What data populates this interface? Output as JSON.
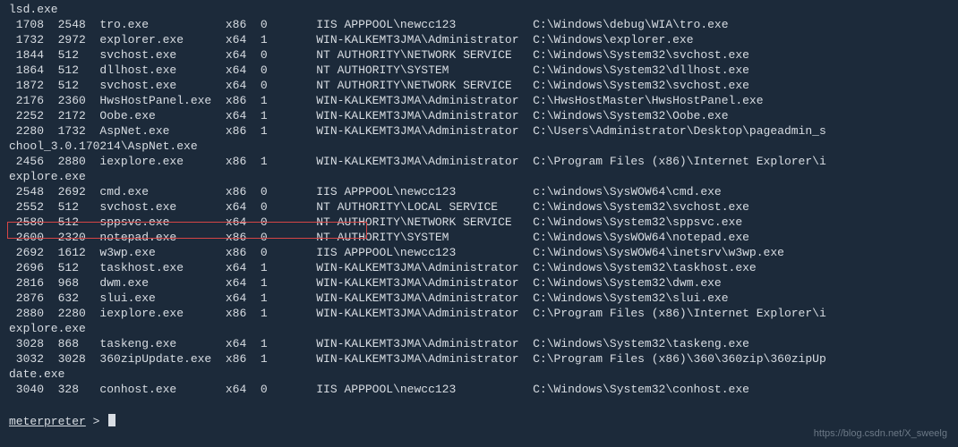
{
  "prompt": "meterpreter",
  "watermark": "https://blog.csdn.net/X_sweelg",
  "highlight_pid": 2600,
  "col_widths": {
    "pid": 6,
    "ppid": 6,
    "name": 18,
    "arch": 5,
    "sess": 4,
    "spacer": 4,
    "user": 30,
    "path_pad": 1
  },
  "wrap_lines": {
    "0": "lsd.exe",
    "9": "chool_3.0.170214\\AspNet.exe",
    "11": "explore.exe",
    "21": "explore.exe",
    "24": "date.exe"
  },
  "processes": [
    {
      "pid": 1708,
      "ppid": 2548,
      "name": "tro.exe",
      "arch": "x86",
      "sess": 0,
      "user": "IIS APPPOOL\\newcc123",
      "path": "C:\\Windows\\debug\\WIA\\tro.exe"
    },
    {
      "pid": 1732,
      "ppid": 2972,
      "name": "explorer.exe",
      "arch": "x64",
      "sess": 1,
      "user": "WIN-KALKEMT3JMA\\Administrator",
      "path": "C:\\Windows\\explorer.exe"
    },
    {
      "pid": 1844,
      "ppid": 512,
      "name": "svchost.exe",
      "arch": "x64",
      "sess": 0,
      "user": "NT AUTHORITY\\NETWORK SERVICE",
      "path": "C:\\Windows\\System32\\svchost.exe"
    },
    {
      "pid": 1864,
      "ppid": 512,
      "name": "dllhost.exe",
      "arch": "x64",
      "sess": 0,
      "user": "NT AUTHORITY\\SYSTEM",
      "path": "C:\\Windows\\System32\\dllhost.exe"
    },
    {
      "pid": 1872,
      "ppid": 512,
      "name": "svchost.exe",
      "arch": "x64",
      "sess": 0,
      "user": "NT AUTHORITY\\NETWORK SERVICE",
      "path": "C:\\Windows\\System32\\svchost.exe"
    },
    {
      "pid": 2176,
      "ppid": 2360,
      "name": "HwsHostPanel.exe",
      "arch": "x86",
      "sess": 1,
      "user": "WIN-KALKEMT3JMA\\Administrator",
      "path": "C:\\HwsHostMaster\\HwsHostPanel.exe"
    },
    {
      "pid": 2252,
      "ppid": 2172,
      "name": "Oobe.exe",
      "arch": "x64",
      "sess": 1,
      "user": "WIN-KALKEMT3JMA\\Administrator",
      "path": "C:\\Windows\\System32\\Oobe.exe"
    },
    {
      "pid": 2280,
      "ppid": 1732,
      "name": "AspNet.exe",
      "arch": "x86",
      "sess": 1,
      "user": "WIN-KALKEMT3JMA\\Administrator",
      "path": "C:\\Users\\Administrator\\Desktop\\pageadmin_s"
    },
    {
      "pid": 2456,
      "ppid": 2880,
      "name": "iexplore.exe",
      "arch": "x86",
      "sess": 1,
      "user": "WIN-KALKEMT3JMA\\Administrator",
      "path": "C:\\Program Files (x86)\\Internet Explorer\\i"
    },
    {
      "pid": 2548,
      "ppid": 2692,
      "name": "cmd.exe",
      "arch": "x86",
      "sess": 0,
      "user": "IIS APPPOOL\\newcc123",
      "path": "c:\\windows\\SysWOW64\\cmd.exe"
    },
    {
      "pid": 2552,
      "ppid": 512,
      "name": "svchost.exe",
      "arch": "x64",
      "sess": 0,
      "user": "NT AUTHORITY\\LOCAL SERVICE",
      "path": "C:\\Windows\\System32\\svchost.exe"
    },
    {
      "pid": 2580,
      "ppid": 512,
      "name": "sppsvc.exe",
      "arch": "x64",
      "sess": 0,
      "user": "NT AUTHORITY\\NETWORK SERVICE",
      "path": "C:\\Windows\\System32\\sppsvc.exe"
    },
    {
      "pid": 2600,
      "ppid": 2320,
      "name": "notepad.exe",
      "arch": "x86",
      "sess": 0,
      "user": "NT AUTHORITY\\SYSTEM",
      "path": "C:\\Windows\\SysWOW64\\notepad.exe"
    },
    {
      "pid": 2692,
      "ppid": 1612,
      "name": "w3wp.exe",
      "arch": "x86",
      "sess": 0,
      "user": "IIS APPPOOL\\newcc123",
      "path": "C:\\Windows\\SysWOW64\\inetsrv\\w3wp.exe"
    },
    {
      "pid": 2696,
      "ppid": 512,
      "name": "taskhost.exe",
      "arch": "x64",
      "sess": 1,
      "user": "WIN-KALKEMT3JMA\\Administrator",
      "path": "C:\\Windows\\System32\\taskhost.exe"
    },
    {
      "pid": 2816,
      "ppid": 968,
      "name": "dwm.exe",
      "arch": "x64",
      "sess": 1,
      "user": "WIN-KALKEMT3JMA\\Administrator",
      "path": "C:\\Windows\\System32\\dwm.exe"
    },
    {
      "pid": 2876,
      "ppid": 632,
      "name": "slui.exe",
      "arch": "x64",
      "sess": 1,
      "user": "WIN-KALKEMT3JMA\\Administrator",
      "path": "C:\\Windows\\System32\\slui.exe"
    },
    {
      "pid": 2880,
      "ppid": 2280,
      "name": "iexplore.exe",
      "arch": "x86",
      "sess": 1,
      "user": "WIN-KALKEMT3JMA\\Administrator",
      "path": "C:\\Program Files (x86)\\Internet Explorer\\i"
    },
    {
      "pid": 3028,
      "ppid": 868,
      "name": "taskeng.exe",
      "arch": "x64",
      "sess": 1,
      "user": "WIN-KALKEMT3JMA\\Administrator",
      "path": "C:\\Windows\\System32\\taskeng.exe"
    },
    {
      "pid": 3032,
      "ppid": 3028,
      "name": "360zipUpdate.exe",
      "arch": "x86",
      "sess": 1,
      "user": "WIN-KALKEMT3JMA\\Administrator",
      "path": "C:\\Program Files (x86)\\360\\360zip\\360zipUp"
    },
    {
      "pid": 3040,
      "ppid": 328,
      "name": "conhost.exe",
      "arch": "x64",
      "sess": 0,
      "user": "IIS APPPOOL\\newcc123",
      "path": "C:\\Windows\\System32\\conhost.exe"
    }
  ],
  "rowsText": []
}
